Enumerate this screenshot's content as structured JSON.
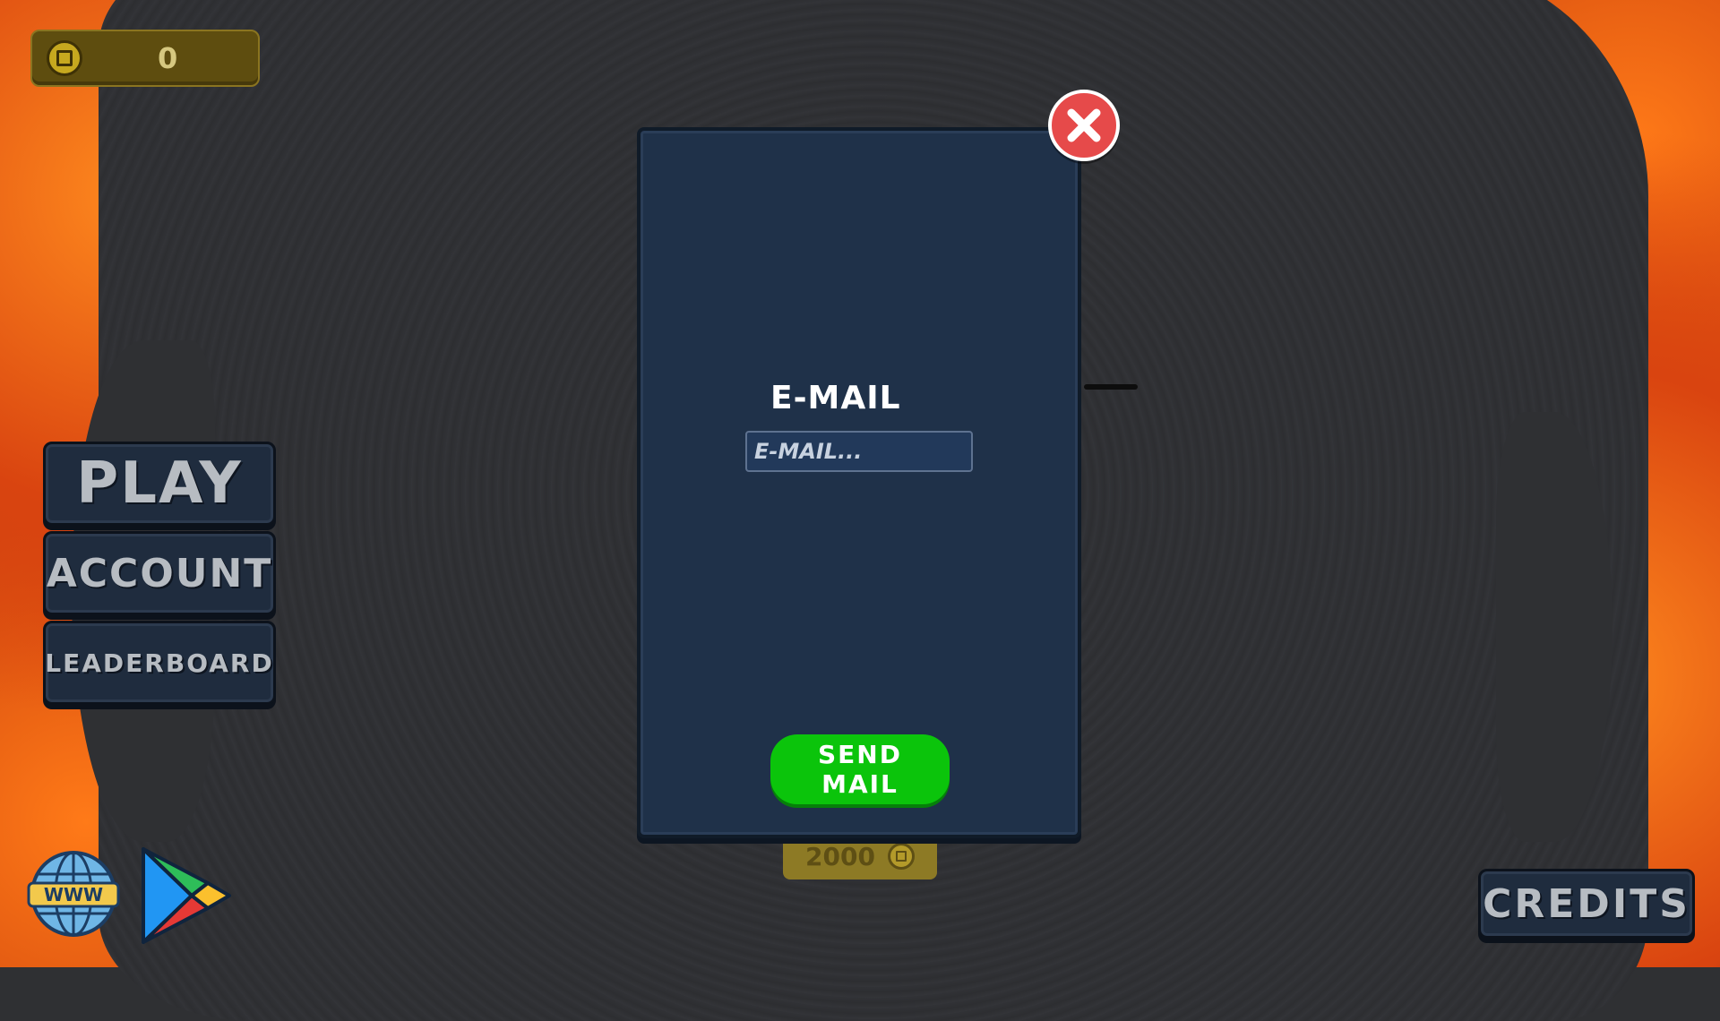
{
  "hud": {
    "coins": "0"
  },
  "menu": {
    "play_label": "PLAY",
    "account_label": "ACCOUNT",
    "leaderboard_label": "LEADERBOARD",
    "credits_label": "CREDITS"
  },
  "links": {
    "website_icon_text": "WWW",
    "website_icon": "globe-icon",
    "store_icon": "google-play-icon"
  },
  "modal": {
    "title": "E-MAIL",
    "email_placeholder": "E-MAIL...",
    "email_value": "",
    "send_label": "SEND MAIL",
    "close_icon": "close-icon",
    "price": "2000"
  },
  "colors": {
    "modal_bg": "#1f3149",
    "send_button": "#0bc40b",
    "close_button": "#e64a4a",
    "coin": "#c6a81f",
    "menu_button": "#1f2c3e"
  }
}
